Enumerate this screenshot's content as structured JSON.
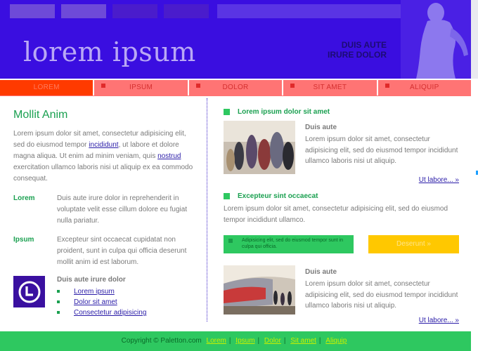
{
  "header": {
    "logo": "lorem ipsum",
    "tagline_line1": "DUIS AUTE",
    "tagline_line2": "IRURE DOLOR"
  },
  "colors": {
    "header_bg": "#3a0ee0",
    "nav_bg": "#ff7474",
    "nav_active": "#ff3a00",
    "accent_green": "#2ec860",
    "heading_green": "#1aa050",
    "promo_yellow": "#ffc800"
  },
  "nav": [
    {
      "label": "LOREM",
      "active": true
    },
    {
      "label": "IPSUM",
      "active": false
    },
    {
      "label": "DOLOR",
      "active": false
    },
    {
      "label": "SIT AMET",
      "active": false
    },
    {
      "label": "ALIQUIP",
      "active": false
    }
  ],
  "left": {
    "title": "Mollit Anim",
    "intro_1": "Lorem ipsum dolor sit amet, consectetur adipisicing elit, sed do eiusmod tempor",
    "intro_link_1": "incididunt",
    "intro_2": "ut labore et dolore magna aliqua. Ut enim ad minim veniam, quis",
    "intro_link_2": "nostrud",
    "intro_3": "exercitation ullamco laboris nisi ut aliquip ex ea commodo consequat.",
    "defs": [
      {
        "term": "Lorem",
        "desc": "Duis aute irure dolor in reprehenderit in voluptate velit esse cillum dolore eu fugiat nulla pariatur."
      },
      {
        "term": "Ipsum",
        "desc": "Excepteur sint occaecat cupidatat non proident, sunt in culpa qui officia deserunt mollit anim id est laborum."
      }
    ],
    "ext_icon": "dial-icon",
    "ext_title": "Duis aute irure dolor",
    "ext_links": [
      "Lorem ipsum",
      "Dolor sit amet",
      "Consectetur adipisicing"
    ]
  },
  "right": {
    "section1_title": "Lorem ipsum dolor sit amet",
    "article1_title": "Duis aute",
    "article1_text": "Lorem ipsum dolor sit amet, consectetur adipisicing elit, sed do eiusmod tempor incididunt ullamco laboris nisi ut aliquip.",
    "article1_more": "Ut labore... »",
    "section2_title": "Excepteur sint occaecat",
    "section2_text": "Lorem ipsum dolor sit amet, consectetur adipisicing elit, sed do eiusmod tempor incididunt ullamco.",
    "promo_green": "Adipisicing elit, sed do eiusmod tempor sunt in culpa qui officia.",
    "promo_yellow": "Deserunt »",
    "article2_title": "Duis aute",
    "article2_text": "Lorem ipsum dolor sit amet, consectetur adipisicing elit, sed do eiusmod tempor incididunt ullamco laboris nisi ut aliquip.",
    "article2_more": "Ut labore... »"
  },
  "footer": {
    "copyright": "Copyright © Paletton.com",
    "links": [
      "Lorem",
      "Ipsum",
      "Dolor",
      "Sit amet",
      "Aliquip"
    ],
    "sep": "|"
  }
}
